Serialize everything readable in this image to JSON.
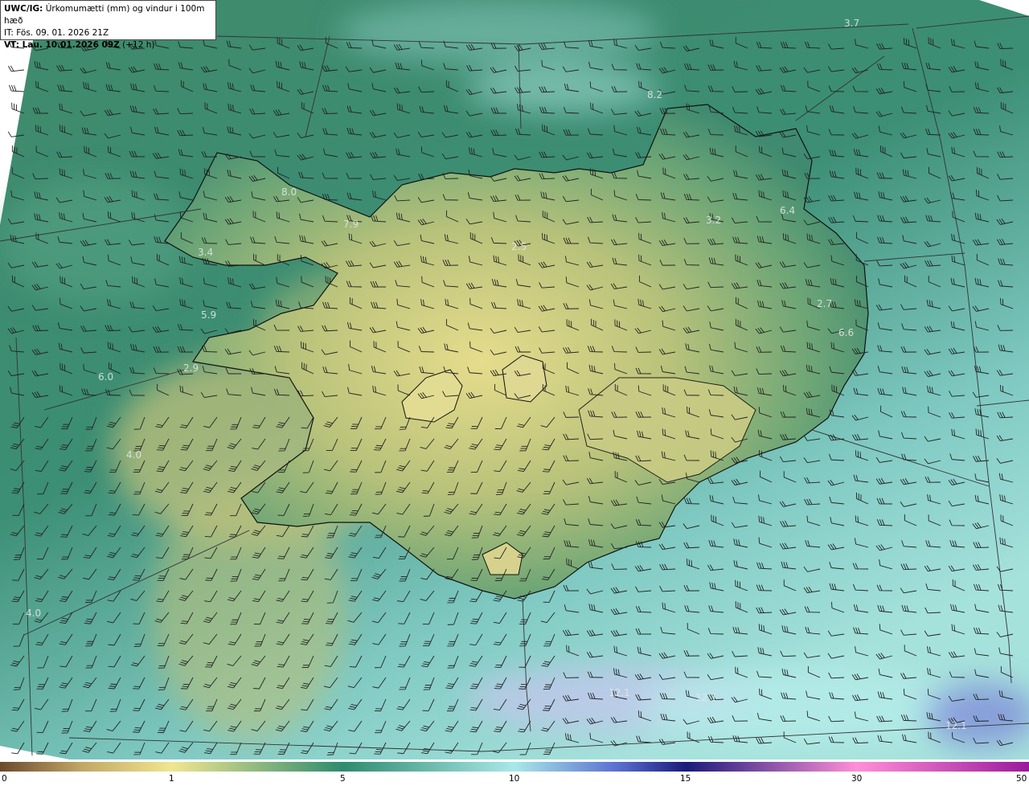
{
  "header": {
    "model": "UWC/IG:",
    "field": "Úrkomumætti (mm) og vindur i 100m hæð",
    "init_time": "IT: Fös. 09. 01. 2026 21Z",
    "valid_prefix": "VT: Lau. 10.01.2026 09Z",
    "valid_suffix": "(+12 h)"
  },
  "map_values": [
    "3.7",
    "8.2",
    "8.0",
    "7.9",
    "3.4",
    "2.5",
    "3.2",
    "6.4",
    "5.9",
    "2.7",
    "6.6",
    "2.9",
    "6.0",
    "4.0",
    "4.0",
    "12.1",
    "12.1",
    "12.1"
  ],
  "colorbar": {
    "ticks": [
      "0",
      "1",
      "5",
      "10",
      "15",
      "30",
      "50"
    ],
    "stops": [
      "#6b4a2e",
      "#f1e690",
      "#2e8b6e",
      "#a9e8e8",
      "#1a1a7a",
      "#ff8fd8",
      "#9b1a9b"
    ]
  },
  "colors": {
    "land_low": "#d8d484",
    "land_mid": "#5fa078",
    "ocean": "#3e8c72",
    "ocean_light": "#9ad6d0",
    "coast": "#111111",
    "barb": "#222222"
  }
}
